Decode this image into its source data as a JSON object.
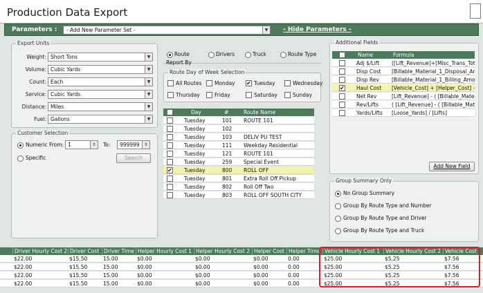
{
  "window": {
    "title": "Production Data Export"
  },
  "parameters": {
    "label": "Parameters :",
    "selected": "- Add New Parameter Set -",
    "hide_link": "- Hide Parameters -"
  },
  "export_units": {
    "legend": "Export Units",
    "fields": [
      {
        "label": "Weight:",
        "value": "Short Tons"
      },
      {
        "label": "Volume:",
        "value": "Cubic Yards"
      },
      {
        "label": "Count:",
        "value": "Each"
      },
      {
        "label": "Service:",
        "value": "Cubic Yards"
      },
      {
        "label": "Distance:",
        "value": "Miles"
      },
      {
        "label": "Fuel:",
        "value": "Gallons"
      }
    ]
  },
  "customer_selection": {
    "legend": "Customer Selection",
    "numeric_label": "Numeric From:",
    "from_value": "1",
    "to_label": "To:",
    "to_value": "999999",
    "specific_label": "Specific",
    "search_label": "Search"
  },
  "report_by": {
    "legend": "Report By",
    "options": [
      "Route",
      "Drivers",
      "Truck",
      "Route Type"
    ],
    "selected": "Route"
  },
  "route_day": {
    "legend": "Route Day of Week Selection",
    "options": [
      {
        "label": "All Routes",
        "checked": false
      },
      {
        "label": "Monday",
        "checked": false
      },
      {
        "label": "Tuesday",
        "checked": true
      },
      {
        "label": "Wednesday",
        "checked": false
      },
      {
        "label": "Thursday",
        "checked": false
      },
      {
        "label": "Friday",
        "checked": false
      },
      {
        "label": "Saturday",
        "checked": false
      },
      {
        "label": "Sunday",
        "checked": false
      }
    ]
  },
  "routes": {
    "headers": [
      "Day",
      "#",
      "Route Name"
    ],
    "rows": [
      {
        "checked": false,
        "day": "Tuesday",
        "num": "101",
        "name": "ROUTE 101"
      },
      {
        "checked": false,
        "day": "Tuesday",
        "num": "102",
        "name": ""
      },
      {
        "checked": false,
        "day": "Tuesday",
        "num": "103",
        "name": "DELIV PU TEST"
      },
      {
        "checked": false,
        "day": "Tuesday",
        "num": "111",
        "name": "Weekday Residential"
      },
      {
        "checked": false,
        "day": "Tuesday",
        "num": "121",
        "name": "ROUTE 101"
      },
      {
        "checked": false,
        "day": "Tuesday",
        "num": "259",
        "name": "Special Event"
      },
      {
        "checked": true,
        "day": "Tuesday",
        "num": "800",
        "name": "ROLL OFF"
      },
      {
        "checked": false,
        "day": "Tuesday",
        "num": "801",
        "name": "Extra Roll Off Pickup"
      },
      {
        "checked": false,
        "day": "Tuesday",
        "num": "802",
        "name": "Roll Off Two"
      },
      {
        "checked": false,
        "day": "Tuesday",
        "num": "803",
        "name": "ROLL OFF SOUTH CITY"
      }
    ]
  },
  "additional_fields": {
    "legend": "Additional Fields",
    "headers": [
      "Name",
      "Formula"
    ],
    "rows": [
      {
        "checked": false,
        "name": "Adj $/Lift",
        "formula": "([Lift_Revenue]+[Misc_Trans_Tot"
      },
      {
        "checked": false,
        "name": "Disp Cost",
        "formula": "[Billable_Material_1_Disposal_Am"
      },
      {
        "checked": false,
        "name": "Disp Rev",
        "formula": "[Billable_Material_1_Billing_Amou"
      },
      {
        "checked": true,
        "name": "Haul Cost",
        "formula": "[Vehicle_Cost] + [Helper_Cost] +"
      },
      {
        "checked": false,
        "name": "Net Rev",
        "formula": "[Lift_Revenue] - ( [Billable_Materi"
      },
      {
        "checked": false,
        "name": "Rev/Lifts",
        "formula": "( [Lift_Revenue] - ( [Billable_Mat"
      },
      {
        "checked": false,
        "name": "Yards/Lifts",
        "formula": "[Loose_Yards] / [Lifts]"
      }
    ],
    "add_button": "Add New Field"
  },
  "group_summary": {
    "legend": "Group Summary Only",
    "options": [
      "No Group Summary",
      "Group By Route Type and Number",
      "Group By Route Type and Driver",
      "Group By Route Type and Truck"
    ],
    "selected": "No Group Summary"
  },
  "results": {
    "headers": [
      "Driver Hourly Cost 2",
      "Driver Cost",
      "Driver Time",
      "Helper Hourly Cost 1",
      "Helper Hourly Cost 2",
      "Helper Cost",
      "Helper Time",
      "Vehicle Hourly Cost 1",
      "Vehicle Hourly Cost 2",
      "Vehicle Cost"
    ],
    "rows": [
      [
        "$22.00",
        "$15.50",
        "15.00",
        "$0.00",
        "$0.00",
        "$0.00",
        "0.00",
        "$25.00",
        "$5.25",
        "$7.56"
      ],
      [
        "$22.00",
        "$15.50",
        "15.00",
        "$0.00",
        "$0.00",
        "$0.00",
        "0.00",
        "$25.00",
        "$5.25",
        "$7.56"
      ],
      [
        "$22.00",
        "$15.50",
        "15.00",
        "$0.00",
        "$0.00",
        "$0.00",
        "0.00",
        "$25.00",
        "$5.25",
        "$7.56"
      ],
      [
        "$22.00",
        "$15.50",
        "15.00",
        "$0.00",
        "$0.00",
        "$0.00",
        "0.00",
        "$25.00",
        "$5.25",
        "$7.56"
      ]
    ]
  },
  "colors": {
    "accent": "#4d7a5a",
    "highlight": "#f5f3b0",
    "callout": "#d4202a"
  }
}
